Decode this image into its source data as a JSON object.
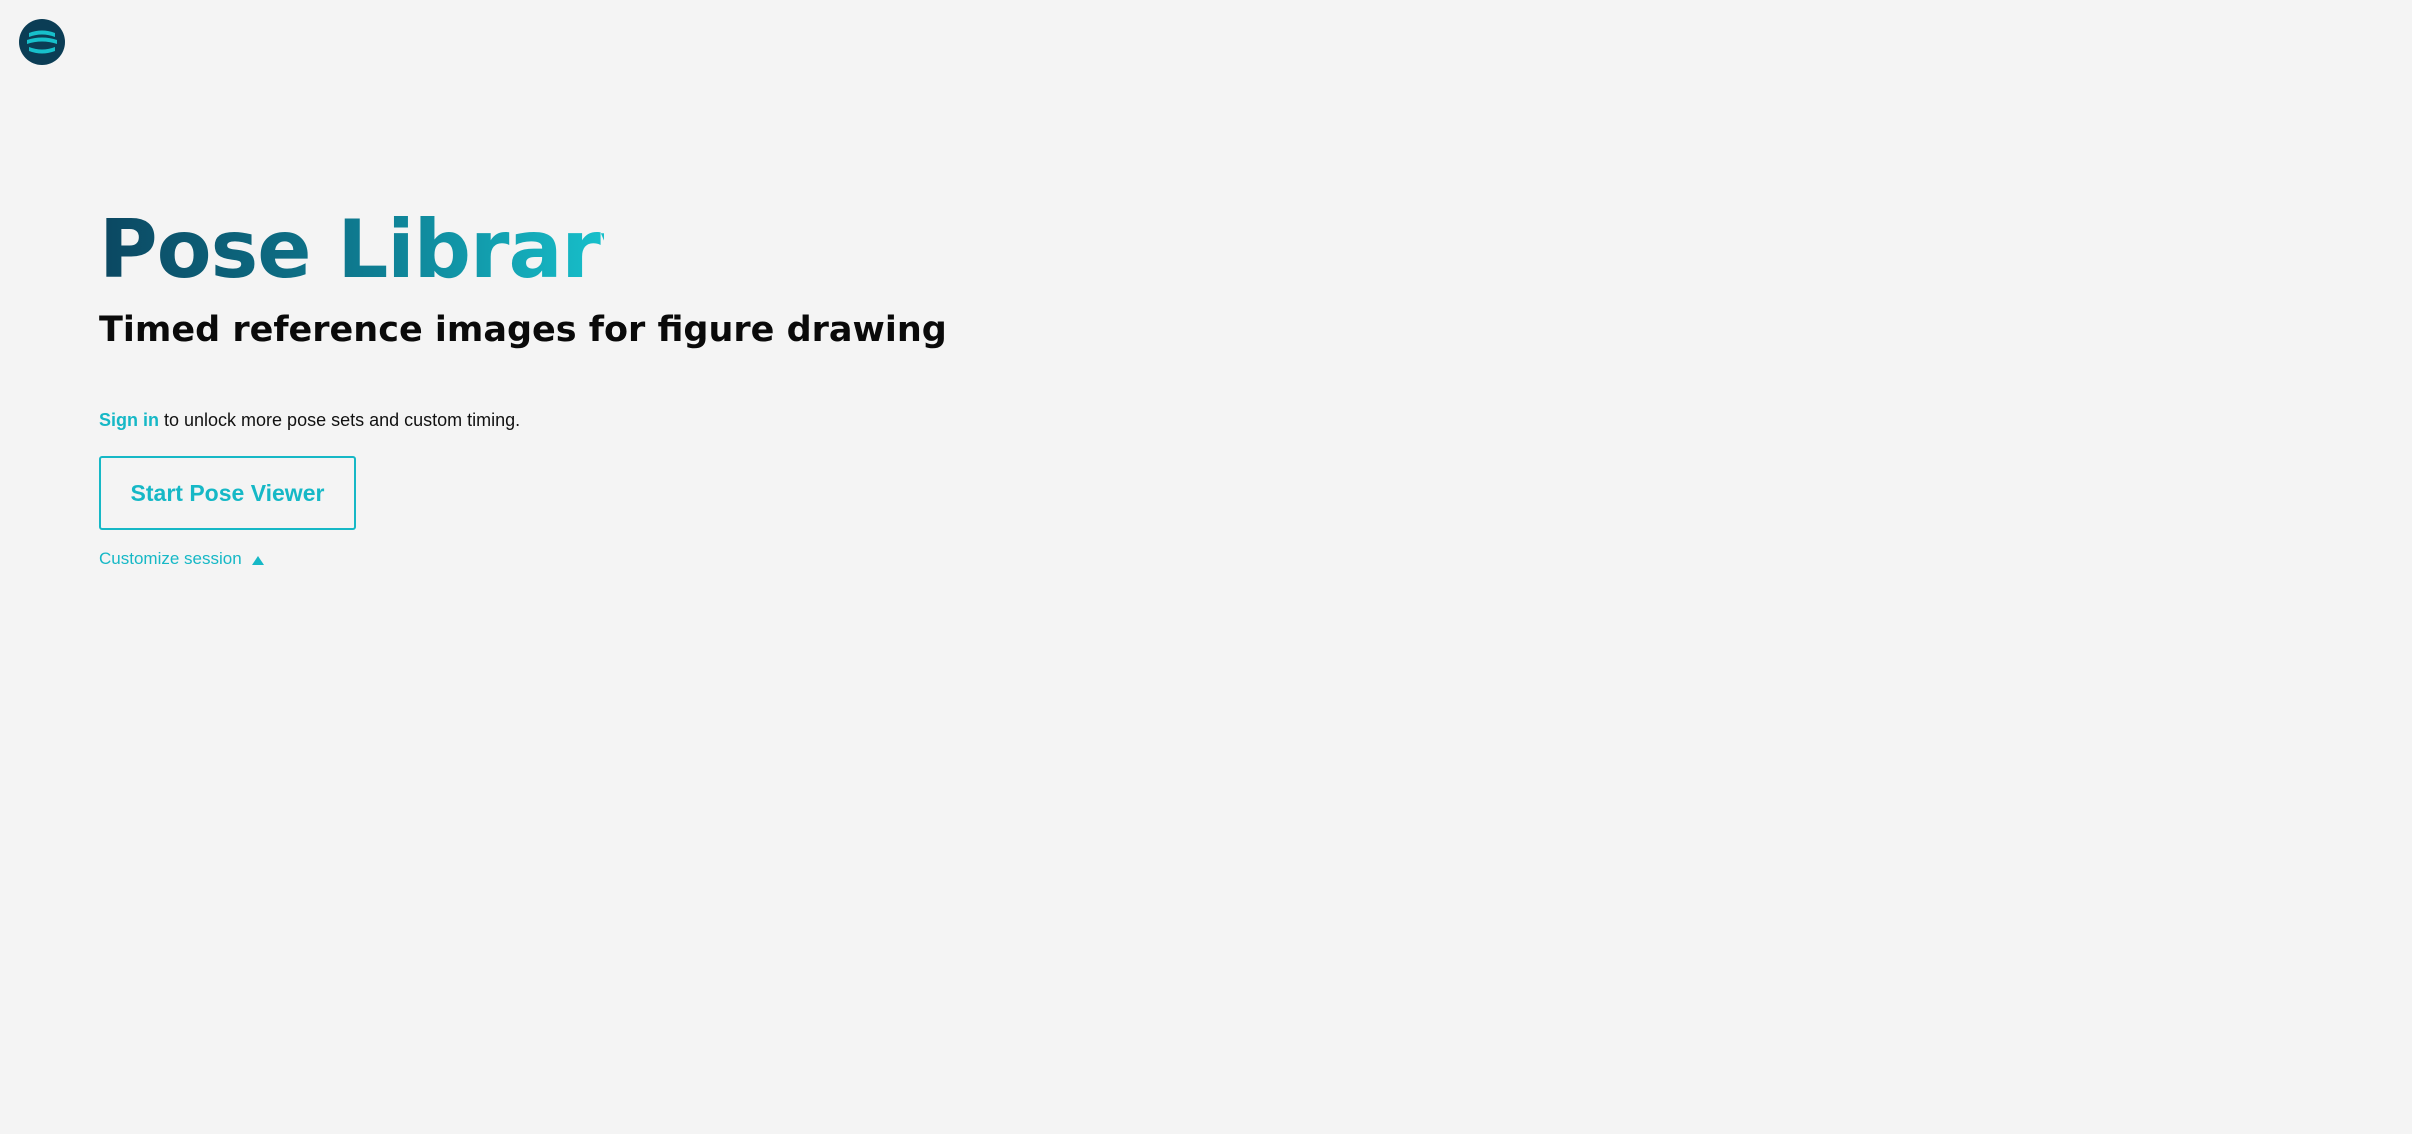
{
  "header": {
    "logo_icon": "app-logo-icon"
  },
  "hero": {
    "title": "Pose Library",
    "subtitle": "Timed reference images for figure drawing",
    "signin_link": "Sign in",
    "signin_text": " to unlock more pose sets and custom timing.",
    "start_button": "Start Pose Viewer",
    "customize_label": "Customize session",
    "customize_icon": "caret-up-icon"
  },
  "colors": {
    "accent": "#16b8c6",
    "title_gradient_start": "#0b4761",
    "title_gradient_end": "#17c0cb",
    "background": "#f4f4f4",
    "logo_bg": "#0b3d55"
  }
}
